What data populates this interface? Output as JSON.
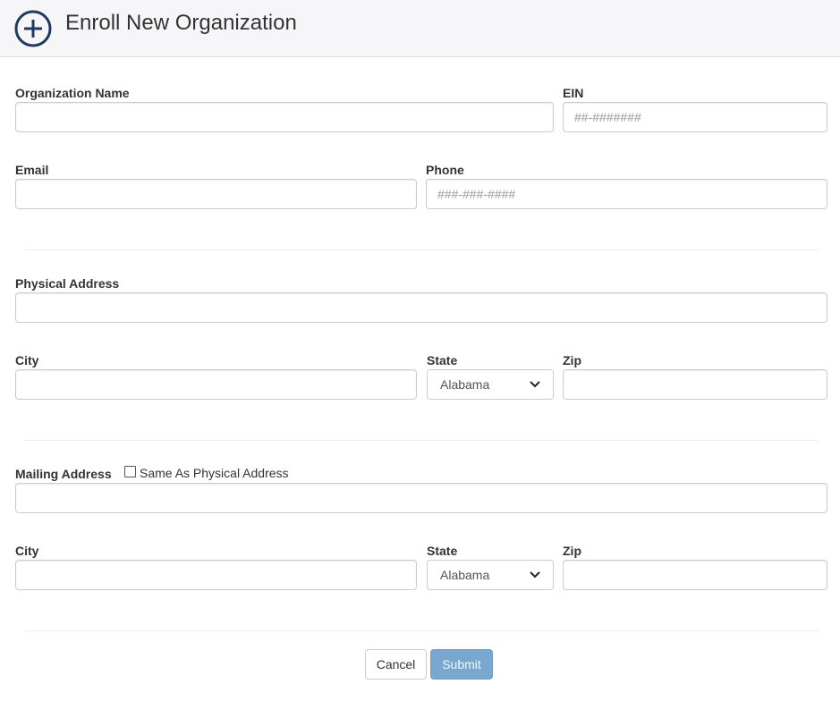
{
  "header": {
    "icon": "plus-circle-icon",
    "title": "Enroll New Organization"
  },
  "organization": {
    "name_label": "Organization Name",
    "name_value": "",
    "ein_label": "EIN",
    "ein_placeholder": "##-#######",
    "email_label": "Email",
    "email_value": "",
    "phone_label": "Phone",
    "phone_placeholder": "###-###-####"
  },
  "physical_address": {
    "address_label": "Physical Address",
    "address_value": "",
    "city_label": "City",
    "city_value": "",
    "state_label": "State",
    "state_selected": "Alabama",
    "zip_label": "Zip",
    "zip_value": ""
  },
  "mailing_address": {
    "address_label": "Mailing Address",
    "same_as_physical_label": "Same As Physical Address",
    "same_as_physical_checked": false,
    "address_value": "",
    "city_label": "City",
    "city_value": "",
    "state_label": "State",
    "state_selected": "Alabama",
    "zip_label": "Zip",
    "zip_value": ""
  },
  "actions": {
    "cancel_label": "Cancel",
    "submit_label": "Submit"
  },
  "colors": {
    "header_icon": "#1f3a5f",
    "submit_bg": "#7aa7d0"
  }
}
